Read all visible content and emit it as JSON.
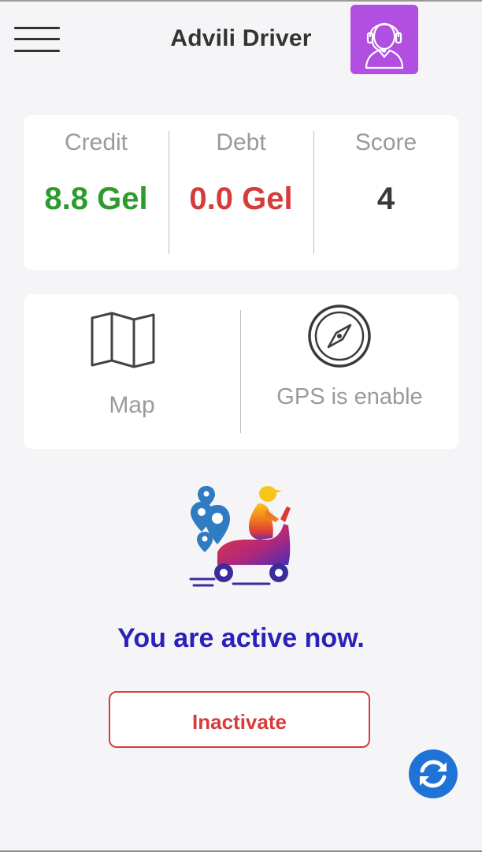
{
  "header": {
    "title": "Advili Driver",
    "menu_icon": "hamburger-menu-icon",
    "support_icon": "headset-agent-icon",
    "support_bg": "#b04fe0"
  },
  "stats": {
    "credit": {
      "label": "Credit",
      "value": "8.8 Gel",
      "color": "#2e9b2e"
    },
    "debt": {
      "label": "Debt",
      "value": "0.0 Gel",
      "color": "#d63c3c"
    },
    "score": {
      "label": "Score",
      "value": "4",
      "color": "#3a3a3a"
    }
  },
  "tools": {
    "map": {
      "label": "Map",
      "icon": "folded-map-icon"
    },
    "gps": {
      "label": "GPS is enable",
      "icon": "compass-icon"
    }
  },
  "status": {
    "text": "You are active now.",
    "color": "#2a22b8",
    "illustration": "delivery-scooter-icon"
  },
  "actions": {
    "inactivate_label": "Inactivate",
    "inactivate_color": "#d63c3c",
    "refresh_icon": "refresh-icon",
    "refresh_bg": "#1f73d6"
  }
}
